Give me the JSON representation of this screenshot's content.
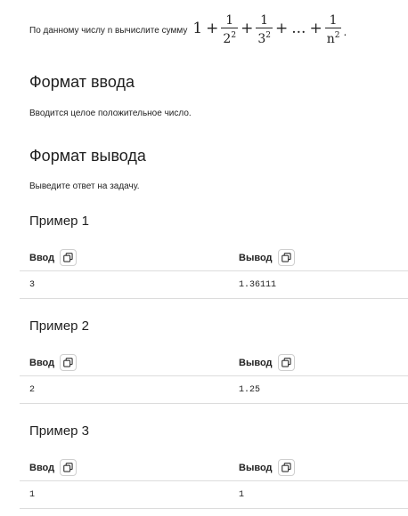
{
  "statement": {
    "text": "По данному числу n вычислите сумму",
    "formula": {
      "lead": "1",
      "plus": "+",
      "terms": [
        {
          "num": "1",
          "den": "2",
          "exp": "2"
        },
        {
          "num": "1",
          "den": "3",
          "exp": "2"
        }
      ],
      "ellipsis": "...",
      "last": {
        "num": "1",
        "den": "n",
        "exp": "2"
      },
      "end": "."
    }
  },
  "input_format": {
    "title": "Формат ввода",
    "text": "Вводится целое положительное число."
  },
  "output_format": {
    "title": "Формат вывода",
    "text": "Выведите ответ на задачу."
  },
  "examples": [
    {
      "title": "Пример 1",
      "input_label": "Ввод",
      "output_label": "Вывод",
      "input": "3",
      "output": "1.36111"
    },
    {
      "title": "Пример 2",
      "input_label": "Ввод",
      "output_label": "Вывод",
      "input": "2",
      "output": "1.25"
    },
    {
      "title": "Пример 3",
      "input_label": "Ввод",
      "output_label": "Вывод",
      "input": "1",
      "output": "1"
    }
  ]
}
